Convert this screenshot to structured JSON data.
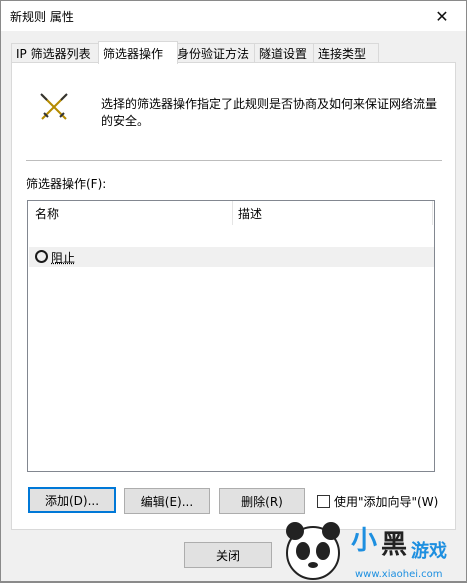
{
  "window": {
    "title": "新规则 属性",
    "close_glyph": "✕"
  },
  "tabs": [
    {
      "label": "IP 筛选器列表"
    },
    {
      "label": "筛选器操作"
    },
    {
      "label": "身份验证方法"
    },
    {
      "label": "隧道设置"
    },
    {
      "label": "连接类型"
    }
  ],
  "panel": {
    "description": "选择的筛选器操作指定了此规则是否协商及如何来保证网络流量的安全。",
    "list_label": "筛选器操作(F):",
    "columns": [
      "名称",
      "描述"
    ],
    "rows": [
      {
        "name": "阻止",
        "selected": true
      }
    ],
    "buttons": {
      "add": "添加(D)...",
      "edit": "编辑(E)...",
      "remove": "删除(R)"
    },
    "wizard_checkbox": "使用\"添加向导\"(W)"
  },
  "footer": {
    "close": "关闭"
  },
  "watermark": {
    "brand": "小黑游戏",
    "url": "www.xiaohei.com"
  },
  "colors": {
    "accent": "#0078d7",
    "panel_bg": "#ffffff",
    "window_bg": "#f0f0f0"
  }
}
